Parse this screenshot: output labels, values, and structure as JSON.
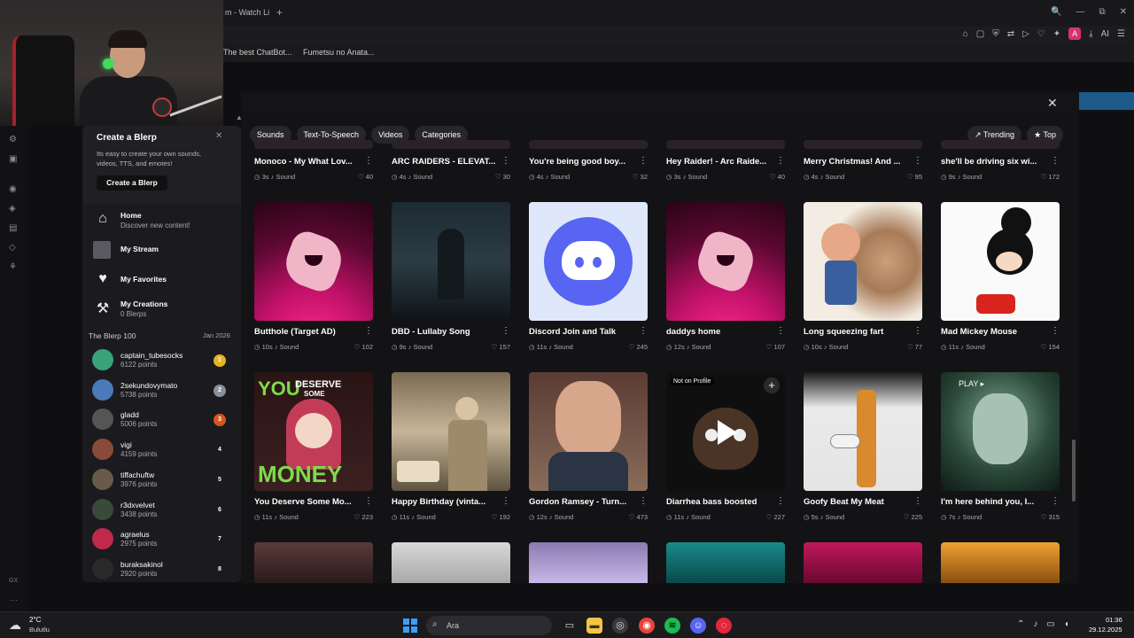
{
  "browser": {
    "tab_title": "m - Watch Li",
    "tab_add": "+",
    "window_controls": [
      "🔍",
      "—",
      "⧉",
      "✕"
    ],
    "ext_ai": "AI",
    "ext_avatar": "A",
    "bookmarks": [
      "The best ChatBot...",
      "Fumetsu no Anata..."
    ]
  },
  "dialog": {
    "close": "✕"
  },
  "sidebar": {
    "create_title": "Create a Blerp",
    "create_close": "✕",
    "create_desc": "Its easy to create your own sounds, videos, TTS, and emotes!",
    "create_button": "Create a Blerp",
    "nav": [
      {
        "label": "Home",
        "sub": "Discover new content!",
        "icon": "home-icon"
      },
      {
        "label": "My Stream",
        "sub": "",
        "icon": "stream-icon"
      },
      {
        "label": "My Favorites",
        "sub": "",
        "icon": "heart-icon"
      },
      {
        "label": "My Creations",
        "sub": "0 Blerps",
        "icon": "hammer-icon"
      }
    ],
    "leaderboard_title": "The Blerp 100",
    "leaderboard_date": "Jan 2026",
    "leaderboard": [
      {
        "name": "captain_tubesocks",
        "points": "6122 points",
        "rank": "1",
        "color": "#e6b325"
      },
      {
        "name": "2sekundovymato",
        "points": "5738 points",
        "rank": "2",
        "color": "#8a8f9c"
      },
      {
        "name": "gladd",
        "points": "5006 points",
        "rank": "3",
        "color": "#d9541e"
      },
      {
        "name": "vigi",
        "points": "4159 points",
        "rank": "4",
        "color": "transparent"
      },
      {
        "name": "tiffachuftw",
        "points": "3976 points",
        "rank": "5",
        "color": "transparent"
      },
      {
        "name": "r3dxvelvet",
        "points": "3438 points",
        "rank": "6",
        "color": "transparent"
      },
      {
        "name": "agraelus",
        "points": "2975 points",
        "rank": "7",
        "color": "transparent"
      },
      {
        "name": "buraksakinol",
        "points": "2920 points",
        "rank": "8",
        "color": "transparent"
      }
    ]
  },
  "filters": [
    "Sounds",
    "Text-To-Speech",
    "Videos",
    "Categories"
  ],
  "sort": [
    "↗ Trending",
    "★ Top"
  ],
  "rows": [
    [
      {
        "title": "Monoco - My What Lov...",
        "dur": "3s",
        "type": "Sound",
        "likes": "40"
      },
      {
        "title": "ARC RAIDERS - ELEVAT...",
        "dur": "4s",
        "type": "Sound",
        "likes": "30"
      },
      {
        "title": "You're being good boy...",
        "dur": "4s",
        "type": "Sound",
        "likes": "32"
      },
      {
        "title": "Hey Raider! - Arc Raide...",
        "dur": "3s",
        "type": "Sound",
        "likes": "40"
      },
      {
        "title": "Merry Christmas! And ...",
        "dur": "4s",
        "type": "Sound",
        "likes": "95"
      },
      {
        "title": "she'll be driving six wi...",
        "dur": "9s",
        "type": "Sound",
        "likes": "172"
      }
    ],
    [
      {
        "title": "Butthole (Target AD)",
        "dur": "10s",
        "type": "Sound",
        "likes": "102",
        "thumb": "blerp"
      },
      {
        "title": "DBD - Lullaby Song",
        "dur": "9s",
        "type": "Sound",
        "likes": "157",
        "thumb": "dark"
      },
      {
        "title": "Discord Join and Talk",
        "dur": "11s",
        "type": "Sound",
        "likes": "245",
        "thumb": "discord"
      },
      {
        "title": "daddys home",
        "dur": "12s",
        "type": "Sound",
        "likes": "107",
        "thumb": "blerp"
      },
      {
        "title": "Long squeezing fart",
        "dur": "10s",
        "type": "Sound",
        "likes": "77",
        "thumb": "cartoon"
      },
      {
        "title": "Mad Mickey Mouse",
        "dur": "11s",
        "type": "Sound",
        "likes": "154",
        "thumb": "mickey"
      }
    ],
    [
      {
        "title": "You Deserve Some Mo...",
        "dur": "11s",
        "type": "Sound",
        "likes": "223",
        "thumb": "money"
      },
      {
        "title": "Happy Birthday (vinta...",
        "dur": "11s",
        "type": "Sound",
        "likes": "192",
        "thumb": "vintage"
      },
      {
        "title": "Gordon Ramsey - Turn...",
        "dur": "12s",
        "type": "Sound",
        "likes": "473",
        "thumb": "gordon"
      },
      {
        "title": "Diarrhea bass boosted",
        "dur": "11s",
        "type": "Sound",
        "likes": "227",
        "thumb": "poop"
      },
      {
        "title": "Goofy Beat My Meat",
        "dur": "5s",
        "type": "Sound",
        "likes": "225",
        "thumb": "goofy"
      },
      {
        "title": "I'm here behind you, I...",
        "dur": "7s",
        "type": "Sound",
        "likes": "315",
        "thumb": "ghost"
      }
    ]
  ],
  "money_text": {
    "line1": "YOU",
    "line2": "DESERVE",
    "line3": "SOME",
    "line4": "MONEY"
  },
  "not_on_profile": "Not on Profile",
  "add_symbol": "+",
  "ghost_text": "PLAY ▸",
  "taskbar": {
    "temp": "2°C",
    "weather": "Bulutlu",
    "search_placeholder": "Ara",
    "time": "01:36",
    "date": "29.12.2025"
  },
  "left_strip": {
    "gx": "GX",
    "dots": "···"
  }
}
